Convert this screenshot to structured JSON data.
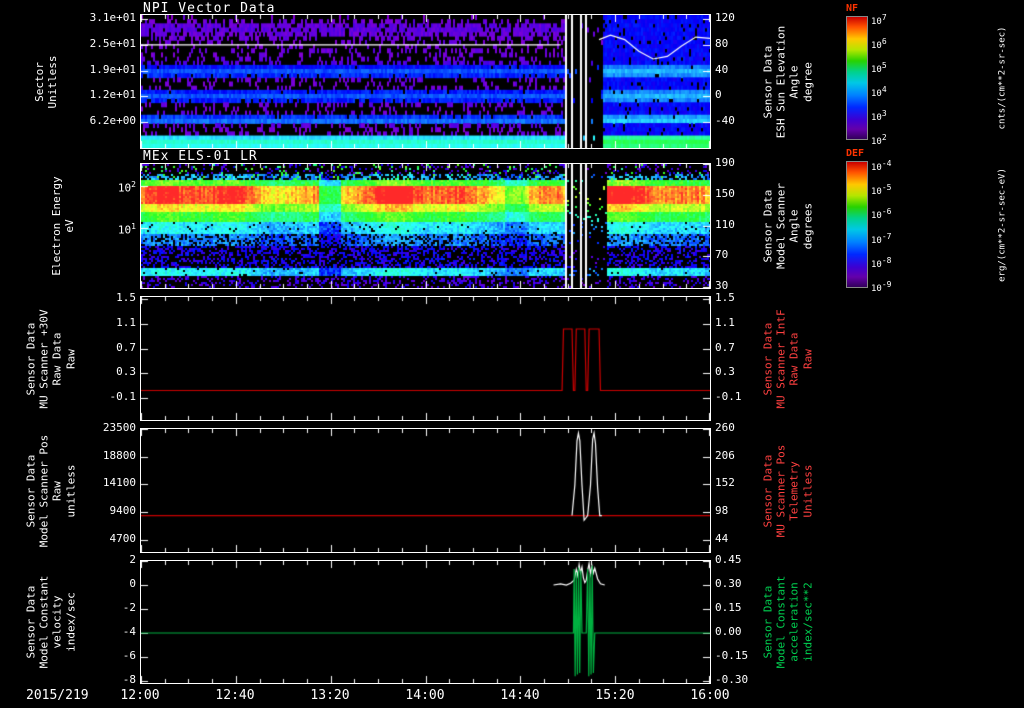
{
  "x_axis": {
    "date_label": "2015/219",
    "tick_labels": [
      "12:00",
      "12:40",
      "13:20",
      "14:00",
      "14:40",
      "15:20",
      "16:00"
    ],
    "hours_start": 12,
    "hours_end": 16
  },
  "colorbars": [
    {
      "title": "NF",
      "title_color": "#ff3300",
      "unit": "cnts/(cm**2-sr-sec)",
      "ticks": [
        "10^7",
        "10^6",
        "10^5",
        "10^4",
        "10^3",
        "10^2"
      ]
    },
    {
      "title": "DEF",
      "title_color": "#ff3300",
      "unit": "erg/(cm**2-sr-sec-eV)",
      "ticks": [
        "10^-4",
        "10^-5",
        "10^-6",
        "10^-7",
        "10^-8",
        "10^-9"
      ]
    }
  ],
  "chart_data": [
    {
      "id": "npi-sector",
      "type": "heatmap",
      "title": "NPI Vector Data",
      "left_label": [
        "Sector",
        "Unitless"
      ],
      "left_ticks": [
        "3.1e+01",
        "2.5e+01",
        "1.9e+01",
        "1.2e+01",
        "6.2e+00"
      ],
      "left_tick_fracs": [
        0.03,
        0.224,
        0.418,
        0.612,
        0.806
      ],
      "right_ticks": [
        "120",
        "80",
        "40",
        "0",
        "-40"
      ],
      "right_tick_fracs": [
        0.03,
        0.224,
        0.418,
        0.612,
        0.806
      ],
      "right_label": [
        "Sensor Data",
        "ESH Sun Elevation",
        "Angle",
        "degree"
      ],
      "right_label_color": "#ffffff",
      "colorbar": "NF",
      "left_scale": {
        "top": 32,
        "bottom": 0
      },
      "right_scale": {
        "top": 126.2,
        "bottom": -80
      },
      "data_gap_hours": [
        14.97,
        15.24
      ],
      "white_stripes_hours": [
        14.99,
        15.03,
        15.09,
        15.13
      ],
      "description": "32-sector NPI count spectrogram: purple speckle band near top, bright blue bands near sectors 12-14, 18-20 and 24-25, bright cyan band at bottom sectors; data gap with white scanner lines near 15:00-15:14; nearly uniform blue fill with cyan base after 15:15",
      "overlay_series": [
        {
          "name": "ESH sun elevation angle",
          "color": "#ffffff",
          "axis": "right",
          "x": [
            12,
            14.95
          ],
          "y": [
            80,
            80
          ]
        },
        {
          "name": "ESH sun elevation angle wave",
          "color": "#ffffff",
          "axis": "right",
          "x": [
            15.22,
            15.3,
            15.4,
            15.5,
            15.6,
            15.7,
            15.8,
            15.9,
            16.0
          ],
          "y": [
            88,
            95,
            88,
            70,
            58,
            62,
            78,
            92,
            90
          ]
        }
      ]
    },
    {
      "id": "els-energy",
      "type": "heatmap",
      "title": "MEx ELS-01 LR",
      "left_label": [
        "Electron Energy",
        "eV"
      ],
      "left_ticks": [
        "10^2",
        "10^1"
      ],
      "left_tick_fracs": [
        0.176,
        0.52
      ],
      "right_ticks": [
        "190",
        "150",
        "110",
        "70",
        "30"
      ],
      "right_tick_fracs": [
        0.0,
        0.248,
        0.496,
        0.744,
        0.992
      ],
      "right_label": [
        "Sensor Data",
        "Model Scanner",
        "Angle",
        "degrees"
      ],
      "right_label_color": "#ffffff",
      "colorbar": "DEF",
      "right_scale": {
        "top": 190,
        "bottom": 28.7
      },
      "data_gap_hours": [
        14.97,
        15.27
      ],
      "white_stripes_hours": [
        14.99,
        15.03,
        15.09,
        15.13
      ],
      "description": "Electron differential energy flux spectrogram: intense red-orange band around 20-80 eV across the interval with yellow-green edges, cyan-blue transition below, blue-purple speckle at low flux, thin cyan line near 6 eV; brief dim interval near 13:20; data gap with white scanner lines near 15:00-15:15"
    },
    {
      "id": "mu-scanner-30v",
      "type": "line",
      "left_label": [
        "Sensor Data",
        "MU Scanner +30V",
        "Raw Data",
        "Raw"
      ],
      "left_ticks": [
        "1.5",
        "1.1",
        "0.7",
        "0.3",
        "-0.1"
      ],
      "left_tick_fracs": [
        0.02,
        0.22,
        0.42,
        0.62,
        0.82
      ],
      "right_ticks": [
        "1.5",
        "1.1",
        "0.7",
        "0.3",
        "-0.1"
      ],
      "right_tick_fracs": [
        0.02,
        0.22,
        0.42,
        0.62,
        0.82
      ],
      "right_label": [
        "Sensor Data",
        "MU Scanner IntF",
        "Raw Data",
        "Raw"
      ],
      "right_label_color": "#ff4040",
      "left_scale": {
        "top": 1.54,
        "bottom": -0.46
      },
      "right_scale": {
        "top": 1.54,
        "bottom": -0.46
      },
      "series": [
        {
          "name": "MU Scanner +30V Raw",
          "color": "#cc0000",
          "axis": "left",
          "x": [
            12,
            14.96,
            14.97,
            15.03,
            15.04,
            15.05,
            15.06,
            15.12,
            15.13,
            15.14,
            15.15,
            15.22,
            15.23,
            16
          ],
          "y": [
            0.02,
            0.02,
            1.02,
            1.02,
            0.02,
            0.02,
            1.02,
            1.02,
            0.02,
            0.02,
            1.02,
            1.02,
            0.02,
            0.02
          ]
        }
      ]
    },
    {
      "id": "model-scanner-pos",
      "type": "line",
      "left_label": [
        "Sensor Data",
        "Model Scanner Pos",
        "Raw",
        "unitless"
      ],
      "left_ticks": [
        "23500",
        "18800",
        "14100",
        "9400",
        "4700"
      ],
      "left_tick_fracs": [
        0.0,
        0.225,
        0.45,
        0.675,
        0.9
      ],
      "right_ticks": [
        "260",
        "206",
        "152",
        "98",
        "44"
      ],
      "right_tick_fracs": [
        0.0,
        0.225,
        0.45,
        0.675,
        0.9
      ],
      "right_label": [
        "Sensor Data",
        "MU Scanner Pos",
        "Telemetry",
        "Unitless"
      ],
      "right_label_color": "#ff4040",
      "left_scale": {
        "top": 23500,
        "bottom": 2611
      },
      "right_scale": {
        "top": 260,
        "bottom": 20
      },
      "series": [
        {
          "name": "Model Scanner Pos Raw",
          "color": "#cc0000",
          "axis": "left",
          "x": [
            12,
            16
          ],
          "y": [
            8800,
            8800
          ]
        },
        {
          "name": "MU Scanner Pos Telemetry",
          "color": "#ffffff",
          "axis": "left",
          "x": [
            15.03,
            15.05,
            15.065,
            15.075,
            15.085,
            15.1,
            15.115,
            15.125,
            15.14,
            15.16,
            15.175,
            15.185,
            15.195,
            15.21,
            15.225,
            15.24
          ],
          "y": [
            8800,
            14000,
            21500,
            22800,
            21500,
            14000,
            8000,
            8300,
            8800,
            14000,
            21800,
            22800,
            21000,
            13500,
            8800,
            8800
          ]
        }
      ]
    },
    {
      "id": "model-constant",
      "type": "line",
      "left_label": [
        "Sensor Data",
        "Model Constant",
        "velocity",
        "index/sec"
      ],
      "left_ticks": [
        "2",
        "0",
        "-2",
        "-4",
        "-6",
        "-8"
      ],
      "left_tick_fracs": [
        0.0,
        0.197,
        0.394,
        0.59,
        0.787,
        0.984
      ],
      "right_ticks": [
        "0.45",
        "0.30",
        "0.15",
        "0.00",
        "-0.15",
        "-0.30"
      ],
      "right_tick_fracs": [
        0.0,
        0.197,
        0.394,
        0.59,
        0.787,
        0.984
      ],
      "right_label": [
        "Sensor Data",
        "Model Constant",
        "acceleration",
        "index/sec**2"
      ],
      "right_label_color": "#00d050",
      "left_scale": {
        "top": 2,
        "bottom": -8.16
      },
      "right_scale": {
        "top": 0.45,
        "bottom": -0.3125
      },
      "series": [
        {
          "name": "Model Constant velocity",
          "color": "#ffffff",
          "axis": "left",
          "x": [
            14.9,
            14.95,
            14.99,
            15.02,
            15.045,
            15.06,
            15.07,
            15.08,
            15.09,
            15.1,
            15.11,
            15.12,
            15.13,
            15.14,
            15.15,
            15.16,
            15.17,
            15.18,
            15.19,
            15.21,
            15.23,
            15.26
          ],
          "y": [
            0.0,
            0.1,
            0.0,
            0.15,
            0.4,
            1.3,
            0.8,
            1.7,
            1.0,
            1.5,
            0.6,
            0.2,
            0.4,
            1.2,
            1.8,
            0.9,
            1.6,
            1.0,
            1.4,
            0.5,
            0.1,
            0.0
          ]
        },
        {
          "name": "Model Constant acceleration",
          "color": "#00b040",
          "axis": "right",
          "x": [
            12,
            15.04,
            15.045,
            15.052,
            15.06,
            15.068,
            15.076,
            15.084,
            15.092,
            15.1,
            15.11,
            15.13,
            15.14,
            15.148,
            15.156,
            15.164,
            15.172,
            15.18,
            15.19,
            15.2,
            16
          ],
          "y": [
            0,
            0,
            0.4,
            -0.27,
            0.38,
            -0.26,
            0.41,
            -0.25,
            0.39,
            0,
            0,
            0,
            0.4,
            -0.27,
            0.37,
            -0.26,
            0.42,
            -0.25,
            0,
            0,
            0
          ]
        }
      ]
    }
  ]
}
